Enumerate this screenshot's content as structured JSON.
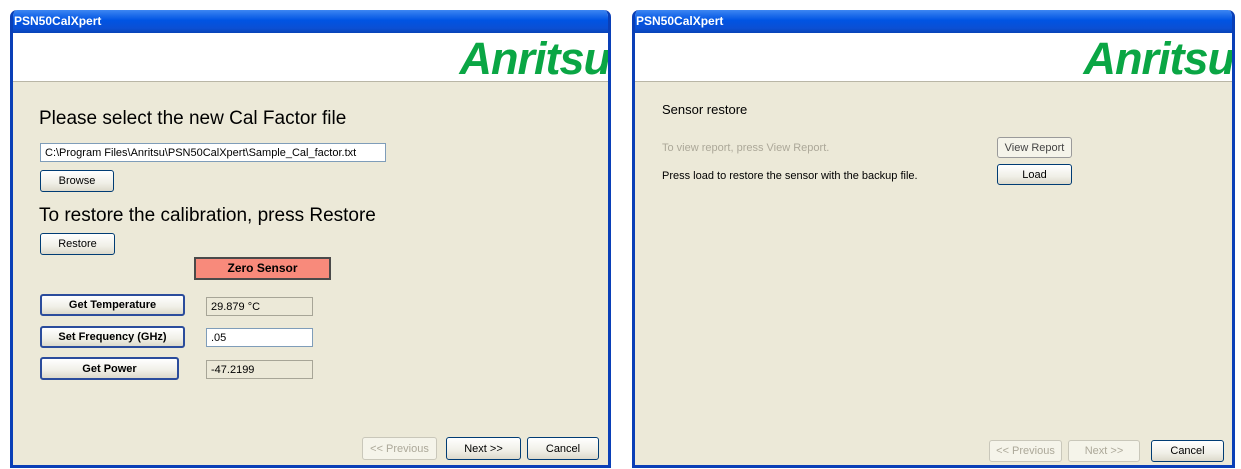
{
  "left": {
    "title": "PSN50CalXpert",
    "logo": "Anritsu",
    "heading_select": "Please select the new Cal Factor file",
    "file_path": "C:\\Program Files\\Anritsu\\PSN50CalXpert\\Sample_Cal_factor.txt",
    "browse_label": "Browse",
    "heading_restore": "To restore the calibration,  press Restore",
    "restore_label": "Restore",
    "zero_sensor_label": "Zero Sensor",
    "get_temperature_label": "Get Temperature",
    "temperature_value": "29.879 °C",
    "set_frequency_label": "Set Frequency (GHz)",
    "frequency_value": ".05",
    "get_power_label": "Get Power",
    "power_value": "-47.2199",
    "previous_label": "<< Previous",
    "next_label": "Next >>",
    "cancel_label": "Cancel"
  },
  "right": {
    "title": "PSN50CalXpert",
    "logo": "Anritsu",
    "section_title": "Sensor restore",
    "view_report_text": "To view report, press View Report.",
    "view_report_label": "View Report",
    "load_text": "Press load to restore the sensor with the backup file.",
    "load_label": "Load",
    "previous_label": "<< Previous",
    "next_label": "Next >>",
    "cancel_label": "Cancel"
  },
  "colors": {
    "brand_green": "#0aa644",
    "titlebar_blue": "#0054e3",
    "zero_sensor": "#f88a7b"
  }
}
